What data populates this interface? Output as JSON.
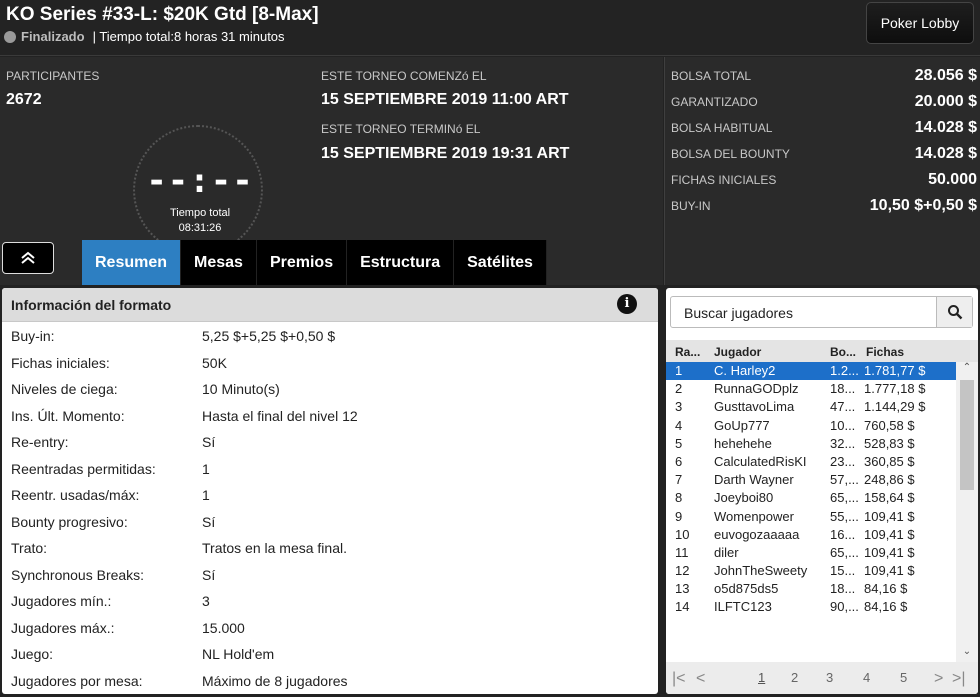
{
  "header": {
    "title": "KO Series #33-L: $20K Gtd [8-Max]",
    "status": "Finalizado",
    "total_time_text": "| Tiempo total:8 horas  31 minutos",
    "lobby_button": "Poker Lobby"
  },
  "summary": {
    "participants_label": "PARTICIPANTES",
    "participants_value": "2672",
    "clock_digits": "--:--",
    "clock_label": "Tiempo total",
    "clock_time": "08:31:26",
    "start_label": "ESTE TORNEO COMENZó EL",
    "start_value": "15 SEPTIEMBRE 2019  11:00 ART",
    "end_label": "ESTE TORNEO TERMINó EL",
    "end_value": "15 SEPTIEMBRE 2019  19:31 ART"
  },
  "prize": {
    "rows": [
      {
        "k": "BOLSA TOTAL",
        "v": "28.056 $"
      },
      {
        "k": "GARANTIZADO",
        "v": "20.000 $"
      },
      {
        "k": "BOLSA HABITUAL",
        "v": "14.028 $"
      },
      {
        "k": "BOLSA DEL BOUNTY",
        "v": "14.028 $"
      },
      {
        "k": "FICHAS INICIALES",
        "v": "50.000"
      },
      {
        "k": "BUY-IN",
        "v": "10,50 $+0,50 $"
      }
    ]
  },
  "tabs": [
    "Resumen",
    "Mesas",
    "Premios",
    "Estructura",
    "Satélites"
  ],
  "format": {
    "title": "Información del formato",
    "rows": [
      {
        "k": "Buy-in:",
        "v": "5,25 $+5,25 $+0,50 $"
      },
      {
        "k": "Fichas iniciales:",
        "v": "50K"
      },
      {
        "k": "Niveles de ciega:",
        "v": "10 Minuto(s)"
      },
      {
        "k": "Ins. Últ. Momento:",
        "v": "Hasta el final del nivel 12"
      },
      {
        "k": "Re-entry:",
        "v": "Sí"
      },
      {
        "k": "Reentradas permitidas:",
        "v": "1"
      },
      {
        "k": "Reentr. usadas/máx:",
        "v": "1"
      },
      {
        "k": "Bounty progresivo:",
        "v": "Sí"
      },
      {
        "k": "Trato:",
        "v": "Tratos en la mesa final."
      },
      {
        "k": "Synchronous Breaks:",
        "v": "Sí"
      },
      {
        "k": "Jugadores mín.:",
        "v": "3"
      },
      {
        "k": "Jugadores máx.:",
        "v": "15.000"
      },
      {
        "k": "Juego:",
        "v": "NL Hold'em"
      },
      {
        "k": "Jugadores por mesa:",
        "v": "Máximo de 8 jugadores"
      }
    ]
  },
  "players": {
    "search_placeholder": "Buscar jugadores",
    "columns": [
      "Ra...",
      "Jugador",
      "Bo...",
      "Fichas"
    ],
    "rows": [
      [
        "1",
        "C. Harley2",
        "1.2...",
        "1.781,77 $"
      ],
      [
        "2",
        "RunnaGODplz",
        "18...",
        "1.777,18 $"
      ],
      [
        "3",
        "GusttavoLima",
        "47...",
        "1.144,29 $"
      ],
      [
        "4",
        "GoUp777",
        "10...",
        "760,58 $"
      ],
      [
        "5",
        "hehehehe",
        "32...",
        "528,83 $"
      ],
      [
        "6",
        "CalculatedRisKI",
        "23...",
        "360,85 $"
      ],
      [
        "7",
        "Darth Wayner",
        "57,...",
        "248,86 $"
      ],
      [
        "8",
        "Joeyboi80",
        "65,...",
        "158,64 $"
      ],
      [
        "9",
        "Womenpower",
        "55,...",
        "109,41 $"
      ],
      [
        "10",
        "euvogozaaaaa",
        "16...",
        "109,41 $"
      ],
      [
        "11",
        "diler",
        "65,...",
        "109,41 $"
      ],
      [
        "12",
        "JohnTheSweety",
        "15...",
        "109,41 $"
      ],
      [
        "13",
        "o5d875ds5",
        "18...",
        "84,16 $"
      ],
      [
        "14",
        "ILFTC123",
        "90,...",
        "84,16 $"
      ]
    ],
    "pages": [
      "1",
      "2",
      "3",
      "4",
      "5"
    ]
  },
  "colors": {
    "accent": "#2d7fc2",
    "selected_row": "#1d6fc9"
  }
}
